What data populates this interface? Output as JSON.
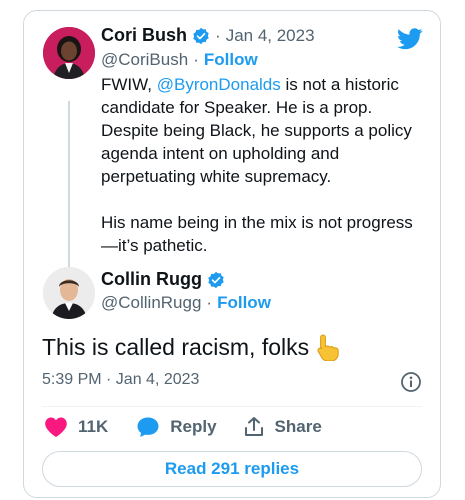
{
  "tweet_parent": {
    "author_name": "Cori Bush",
    "handle": "@CoriBush",
    "date": "Jan 4, 2023",
    "follow_label": "Follow",
    "text_prefix": "FWIW, ",
    "mention": "@ByronDonalds",
    "text_line_rest": " is not a historic candidate for Speaker. He is a prop. Despite being Black, he supports a policy agenda intent on upholding and perpetuating white supremacy.",
    "text_paragraph2": "His name being in the mix is not progress —it’s pathetic."
  },
  "tweet_main": {
    "author_name": "Collin Rugg",
    "handle": "@CollinRugg",
    "follow_label": "Follow",
    "text": "This is called racism, folks",
    "timestamp": "5:39 PM · Jan 4, 2023"
  },
  "actions": {
    "likes": "11K",
    "reply_label": "Reply",
    "share_label": "Share"
  },
  "read_replies_label": "Read 291 replies",
  "separator": "·",
  "colors": {
    "accent": "#1d9bf0",
    "like": "#f91880",
    "muted": "#536471",
    "border": "#cfd9de"
  },
  "icons": [
    "twitter-bird-icon",
    "verified-badge-icon",
    "pointing-hand-emoji",
    "info-icon",
    "heart-icon",
    "reply-bubble-icon",
    "share-icon"
  ]
}
